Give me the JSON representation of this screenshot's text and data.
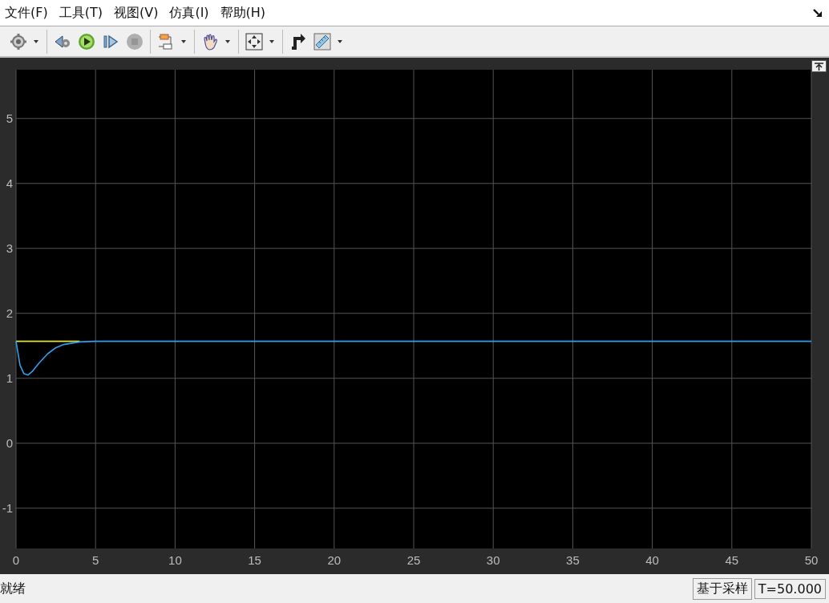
{
  "menu": [
    {
      "label": "文件(F)"
    },
    {
      "label": "工具(T)"
    },
    {
      "label": "视图(V)"
    },
    {
      "label": "仿真(I)"
    },
    {
      "label": "帮助(H)"
    }
  ],
  "toolbar": [
    {
      "kind": "settings",
      "disabled": false,
      "dropdown": true
    },
    {
      "kind": "separator"
    },
    {
      "kind": "step-back",
      "disabled": false,
      "dropdown": false
    },
    {
      "kind": "run",
      "disabled": false,
      "dropdown": false
    },
    {
      "kind": "step-forward",
      "disabled": false,
      "dropdown": false
    },
    {
      "kind": "stop",
      "disabled": true,
      "dropdown": false
    },
    {
      "kind": "separator"
    },
    {
      "kind": "highlight",
      "disabled": false,
      "dropdown": true
    },
    {
      "kind": "separator"
    },
    {
      "kind": "pan",
      "disabled": false,
      "dropdown": true
    },
    {
      "kind": "separator"
    },
    {
      "kind": "fit",
      "disabled": false,
      "dropdown": true
    },
    {
      "kind": "separator"
    },
    {
      "kind": "trigger",
      "disabled": false,
      "dropdown": false
    },
    {
      "kind": "measure",
      "disabled": false,
      "dropdown": true
    }
  ],
  "plot": {
    "chart_data": {
      "type": "line",
      "grid": true,
      "x": [
        0,
        0.25,
        0.5,
        0.75,
        1,
        1.5,
        2,
        2.5,
        3,
        4,
        5,
        10,
        20,
        30,
        40,
        50
      ],
      "xlim": [
        0,
        50
      ],
      "ylim": [
        -1.62,
        5.75
      ],
      "xticks": [
        0,
        5,
        10,
        15,
        20,
        25,
        30,
        35,
        40,
        45,
        50
      ],
      "yticks": [
        -1,
        0,
        1,
        2,
        3,
        4,
        5
      ],
      "series": [
        {
          "color": "#e6e62e",
          "values": [
            1.57,
            1.57,
            1.57,
            1.57,
            1.57,
            1.57,
            1.57,
            1.57,
            1.57,
            1.57,
            null,
            null,
            null,
            null,
            null,
            null
          ]
        },
        {
          "color": "#2f9ff0",
          "values": [
            1.57,
            1.2,
            1.07,
            1.05,
            1.1,
            1.25,
            1.38,
            1.47,
            1.52,
            1.56,
            1.57,
            1.57,
            1.57,
            1.57,
            1.57,
            1.57
          ]
        }
      ]
    }
  },
  "status_bar": {
    "state": "就绪",
    "mode": "基于采样",
    "time": "T=50.000"
  }
}
